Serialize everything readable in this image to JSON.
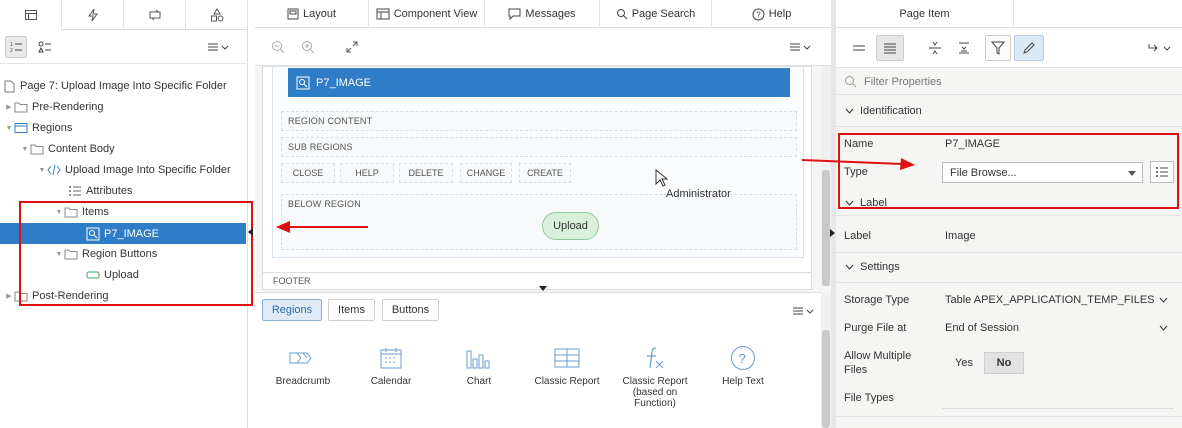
{
  "left_tabs": [
    "rendering-icon",
    "dynamic-actions-icon",
    "processing-icon",
    "shared-components-icon"
  ],
  "tree": {
    "page": "Page 7: Upload Image Into Specific Folder",
    "pre_rendering": "Pre-Rendering",
    "regions": "Regions",
    "content_body": "Content Body",
    "region": "Upload Image Into Specific Folder",
    "attributes": "Attributes",
    "items": "Items",
    "item": "P7_IMAGE",
    "region_buttons": "Region Buttons",
    "upload": "Upload",
    "post_rendering": "Post-Rendering"
  },
  "center_tabs": {
    "layout": "Layout",
    "component_view": "Component View",
    "messages": "Messages",
    "page_search": "Page Search",
    "help": "Help"
  },
  "canvas": {
    "item_label": "P7_IMAGE",
    "region_content": "REGION CONTENT",
    "sub_regions": "SUB REGIONS",
    "buttons": [
      "CLOSE",
      "HELP",
      "DELETE",
      "CHANGE",
      "CREATE"
    ],
    "below_region": "BELOW REGION",
    "upload_button": "Upload",
    "footer": "FOOTER",
    "cursor_tooltip": "Administrator"
  },
  "gallery": {
    "tabs": [
      "Regions",
      "Items",
      "Buttons"
    ],
    "active_tab": "Regions",
    "items": [
      {
        "label": "Breadcrumb",
        "icon": "breadcrumb-icon"
      },
      {
        "label": "Calendar",
        "icon": "calendar-icon"
      },
      {
        "label": "Chart",
        "icon": "chart-icon"
      },
      {
        "label": "Classic Report",
        "icon": "classic-report-icon"
      },
      {
        "label": "Classic Report (based on Function)",
        "icon": "function-icon"
      },
      {
        "label": "Help Text",
        "icon": "help-icon"
      }
    ]
  },
  "property_editor": {
    "tab": "Page Item",
    "filter_placeholder": "Filter Properties",
    "sections": {
      "identification": "Identification",
      "label": "Label",
      "settings": "Settings"
    },
    "fields": {
      "name_label": "Name",
      "name_value": "P7_IMAGE",
      "type_label": "Type",
      "type_value": "File Browse...",
      "label_label": "Label",
      "label_value": "Image",
      "storage_type_label": "Storage Type",
      "storage_type_value": "Table APEX_APPLICATION_TEMP_FILES",
      "purge_label": "Purge File at",
      "purge_value": "End of Session",
      "allow_multiple_label_1": "Allow Multiple",
      "allow_multiple_label_2": "Files",
      "allow_yes": "Yes",
      "allow_no": "No",
      "file_types_label": "File Types"
    }
  },
  "colors": {
    "selected_blue": "#2f7dc6",
    "annotation_red": "#e01010",
    "upload_green": "#d9f0dc"
  }
}
